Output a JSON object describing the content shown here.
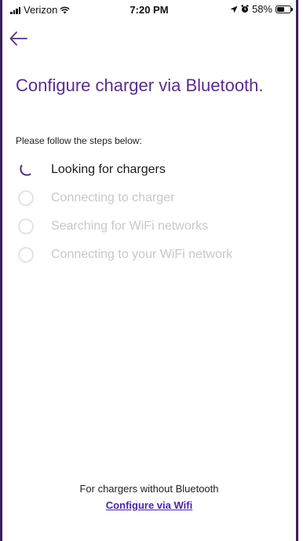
{
  "status_bar": {
    "carrier": "Verizon",
    "time": "7:20 PM",
    "battery": "58%",
    "battery_level": 0.58,
    "icons": [
      "signal-icon",
      "wifi-icon",
      "location-arrow-icon",
      "alarm-icon",
      "battery-icon"
    ]
  },
  "header": {
    "back_icon": "back-arrow-icon"
  },
  "content": {
    "title": "Configure charger via Bluetooth.",
    "subtitle": "Please follow the steps below:",
    "steps": [
      {
        "label": "Looking for chargers",
        "state": "active"
      },
      {
        "label": "Connecting to charger",
        "state": "pending"
      },
      {
        "label": "Searching for WiFi networks",
        "state": "pending"
      },
      {
        "label": "Connecting to your WiFi network",
        "state": "pending"
      }
    ]
  },
  "footer": {
    "text": "For chargers without Bluetooth",
    "link": "Configure via Wifi"
  },
  "colors": {
    "accent": "#5b2c8f",
    "link": "#4b26a6",
    "inactive": "#c7c7cf",
    "frame": "#3a1d5c"
  }
}
